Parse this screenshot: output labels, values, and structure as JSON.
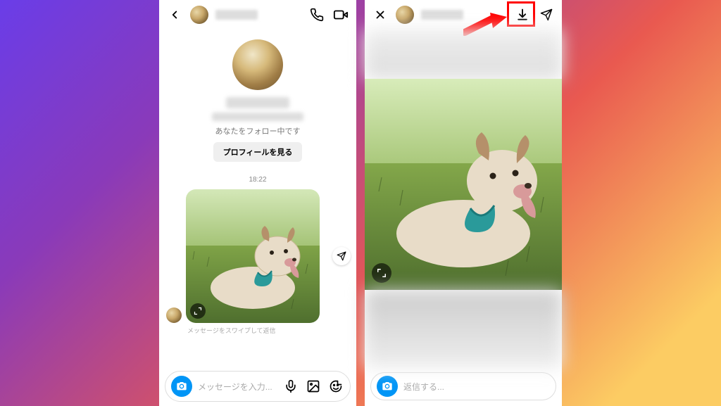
{
  "left": {
    "follow_status": "あなたをフォロー中です",
    "profile_button": "プロフィールを見る",
    "timestamp": "18:22",
    "swipe_hint": "メッセージをスワイプして返信",
    "input_placeholder": "メッセージを入力..."
  },
  "right": {
    "input_placeholder": "返信する..."
  },
  "colors": {
    "accent": "#0095f6",
    "highlight": "#ff0000"
  }
}
